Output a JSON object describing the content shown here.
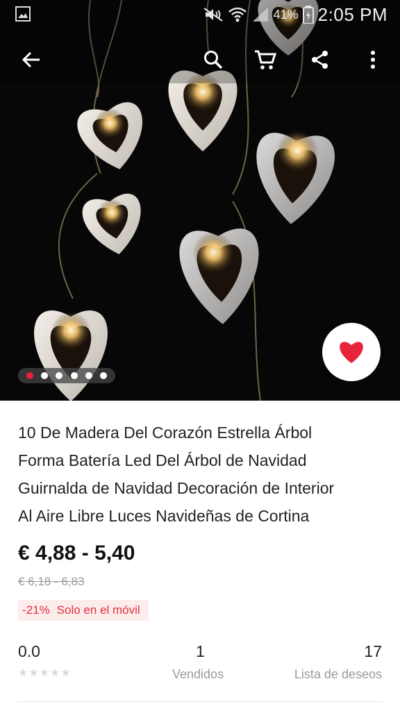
{
  "status_bar": {
    "battery_percent": "41%",
    "time": "2:05 PM",
    "icons": [
      "gallery-icon",
      "mute-icon",
      "wifi-icon",
      "signal-icon",
      "battery-charging-icon"
    ]
  },
  "toolbar": {
    "icons": [
      "back-arrow-icon",
      "search-icon",
      "cart-icon",
      "share-icon",
      "more-vert-icon"
    ]
  },
  "gallery": {
    "image_count": 6,
    "active_index": 0
  },
  "product": {
    "title_lines": [
      "10 De Madera Del Corazón Estrella Árbol",
      "Forma Batería Led Del Árbol de Navidad",
      "Guirnalda de Navidad Decoración de Interior",
      "Al Aire Libre Luces Navideñas de Cortina"
    ],
    "price": "€ 4,88 - 5,40",
    "original_price": "€ 6,18 - 6,83",
    "discount": "-21%",
    "promo_text": "Solo en el móvil"
  },
  "stats": {
    "rating_value": "0.0",
    "rating_stars": 0,
    "sold_count": "1",
    "sold_label": "Vendidos",
    "wishlist_count": "17",
    "wishlist_label": "Lista de deseos"
  },
  "colors": {
    "accent_red": "#e8243a",
    "promo_bg": "#fdecec",
    "promo_text": "#e0303e"
  }
}
